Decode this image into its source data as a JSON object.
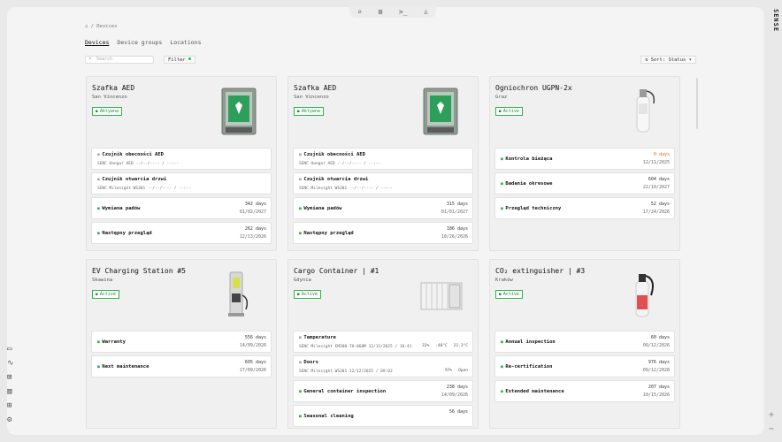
{
  "topbar": {
    "search": "⌕",
    "add": "⊞",
    "terminal": ">_",
    "user": "♙"
  },
  "brand": "SENSE",
  "breadcrumb": "⌂ / Devices",
  "tabs": [
    "Devices",
    "Device groups",
    "Locations"
  ],
  "search": {
    "placeholder": "Search"
  },
  "filter": {
    "label": "Filter"
  },
  "sort": {
    "label": "⇅ Sort: Status ▾"
  },
  "left_nav": [
    "▭",
    "∿",
    "⊠",
    "▥",
    "⊞",
    "⚙"
  ],
  "right_buttons": [
    "+",
    "−"
  ],
  "colors": {
    "accent": "#2db34a",
    "warning": "#e86a1c"
  },
  "cards": [
    {
      "title": "Szafka AED",
      "location": "San Vincenzo",
      "status": "Aktywna",
      "image": "aed-cabinet",
      "rows": [
        {
          "label": "Czujnik obecności AED",
          "meta": "SENC Hangar AED  --/--/---- / --:--"
        },
        {
          "label": "Czujnik otwarcia drzwi",
          "meta": "SENC Milesight WS301  --/--/---- / --:--"
        },
        {
          "label": "Wymiana padów",
          "days": "342 days",
          "date": "01/02/2027"
        },
        {
          "label": "Następny przegląd",
          "days": "262 days",
          "date": "12/13/2026"
        }
      ]
    },
    {
      "title": "Szafka AED",
      "location": "San Vincenzo",
      "status": "Aktywna",
      "image": "aed-cabinet",
      "rows": [
        {
          "label": "Czujnik obecności AED",
          "meta": "SENC Hangar AED  --/--/---- / --:--"
        },
        {
          "label": "Czujnik otwarcia drzwi",
          "meta": "SENC Milesight WS301  --/--/---- / --:--"
        },
        {
          "label": "Wymiana padów",
          "days": "315 days",
          "date": "01/01/2027"
        },
        {
          "label": "Następny przegląd",
          "days": "186 days",
          "date": "10/26/2026"
        }
      ]
    },
    {
      "title": "Ogniochron UGPN-2x",
      "location": "Graz",
      "status": "Active",
      "image": "extinguisher",
      "rows": [
        {
          "label": "Kontrola bieżąca",
          "days": "0 days",
          "date": "12/11/2025",
          "warn": true
        },
        {
          "label": "Badania okresowe",
          "days": "604 days",
          "date": "22/10/2027"
        },
        {
          "label": "Przegląd techniczny",
          "days": "52 days",
          "date": "17/24/2026"
        }
      ]
    },
    {
      "title": "EV Charging Station #5",
      "location": "Skawina",
      "status": "Active",
      "image": "ev-charger",
      "rows": [
        {
          "label": "Warranty",
          "days": "556 days",
          "date": "14/09/2026"
        },
        {
          "label": "Next maintenance",
          "days": "605 days",
          "date": "17/09/2026"
        }
      ]
    },
    {
      "title": "Cargo Container | #1",
      "location": "Gdynia",
      "status": "Active",
      "image": "container",
      "rows": [
        {
          "label": "Temperature",
          "meta": "SENC Milesight EM300-TH-868M  12/12/2025 / 10:41",
          "icons": [
            "32%",
            "-40°C",
            "21.3°C"
          ]
        },
        {
          "label": "Doors",
          "meta": "SENC Milesight WS301  12/12/2025 / 09:02",
          "icons": [
            "97%",
            "Open"
          ]
        },
        {
          "label": "General container inspection",
          "days": "238 days",
          "date": "14/09/2026"
        },
        {
          "label": "Seasonal cleaning",
          "days": "56 days",
          "date": ""
        }
      ]
    },
    {
      "title": "CO₂ extinguisher | #3",
      "location": "Kraków",
      "status": "Active",
      "image": "co2-extinguisher",
      "rows": [
        {
          "label": "Annual inspection",
          "days": "60 days",
          "date": "09/12/2026"
        },
        {
          "label": "Re-certification",
          "days": "976 days",
          "date": "09/12/2028"
        },
        {
          "label": "Extended maintenance",
          "days": "207 days",
          "date": "10/15/2026"
        }
      ]
    }
  ]
}
